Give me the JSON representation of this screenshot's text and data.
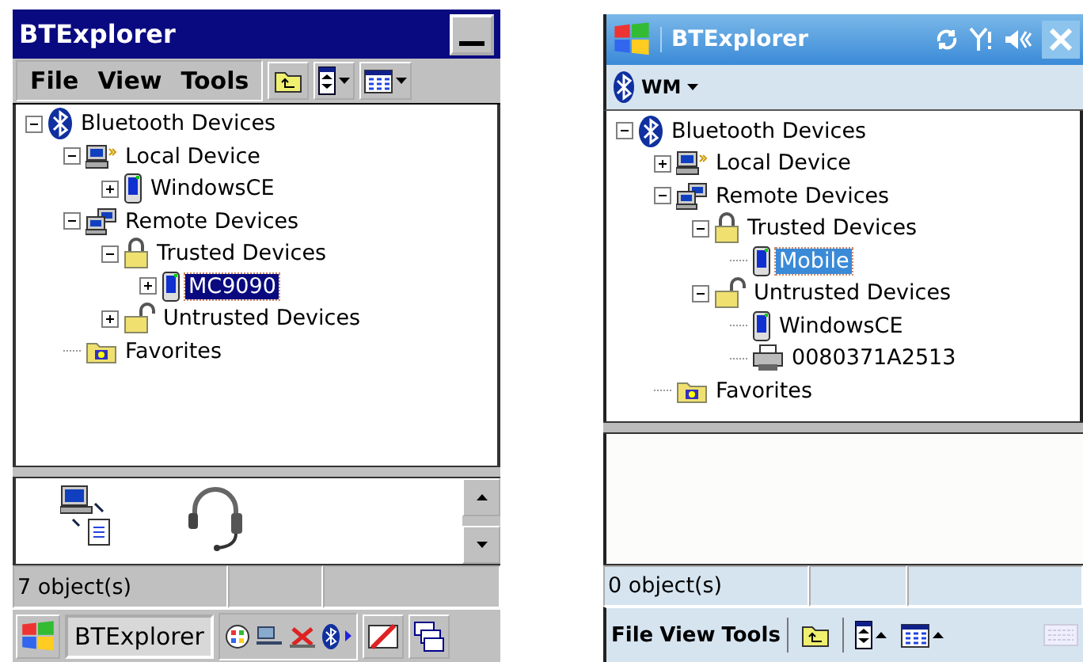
{
  "left_device": {
    "window": {
      "title": "BTExplorer"
    },
    "menu": [
      "File",
      "View",
      "Tools"
    ],
    "tree": [
      {
        "label": "Bluetooth Devices",
        "kind": "bluetooth",
        "expanded": true,
        "selected": false,
        "children": [
          {
            "label": "Local Device",
            "kind": "local",
            "expanded": true,
            "selected": false,
            "children": [
              {
                "label": "WindowsCE",
                "kind": "pda",
                "expanded": false,
                "selected": false
              }
            ]
          },
          {
            "label": "Remote Devices",
            "kind": "remote",
            "expanded": true,
            "selected": false,
            "children": [
              {
                "label": "Trusted Devices",
                "kind": "lock",
                "expanded": true,
                "selected": false,
                "children": [
                  {
                    "label": "MC9090",
                    "kind": "pda",
                    "expanded": false,
                    "selected": true
                  }
                ]
              },
              {
                "label": "Untrusted Devices",
                "kind": "unlock",
                "expanded": false,
                "selected": false
              }
            ]
          },
          {
            "label": "Favorites",
            "kind": "folder",
            "selected": false
          }
        ]
      }
    ],
    "status_bar": "7 object(s)",
    "taskbar": {
      "task": "BTExplorer"
    }
  },
  "right_device": {
    "window": {
      "title": "BTExplorer"
    },
    "toolbar": {
      "label": "WM"
    },
    "tree": [
      {
        "label": "Bluetooth Devices",
        "kind": "bluetooth",
        "expanded": true,
        "selected": false,
        "children": [
          {
            "label": "Local Device",
            "kind": "local",
            "expanded": false,
            "selected": false
          },
          {
            "label": "Remote Devices",
            "kind": "remote",
            "expanded": true,
            "selected": false,
            "children": [
              {
                "label": "Trusted Devices",
                "kind": "lock",
                "expanded": true,
                "selected": false,
                "children": [
                  {
                    "label": "Mobile",
                    "kind": "pda",
                    "selected": true
                  }
                ]
              },
              {
                "label": "Untrusted Devices",
                "kind": "unlock",
                "expanded": true,
                "selected": false,
                "children": [
                  {
                    "label": "WindowsCE",
                    "kind": "pda",
                    "selected": false
                  },
                  {
                    "label": "0080371A2513",
                    "kind": "printer",
                    "selected": false
                  }
                ]
              }
            ]
          },
          {
            "label": "Favorites",
            "kind": "folder",
            "selected": false
          }
        ]
      }
    ],
    "status_bar": "0 object(s)",
    "menu": [
      "File",
      "View",
      "Tools"
    ]
  }
}
